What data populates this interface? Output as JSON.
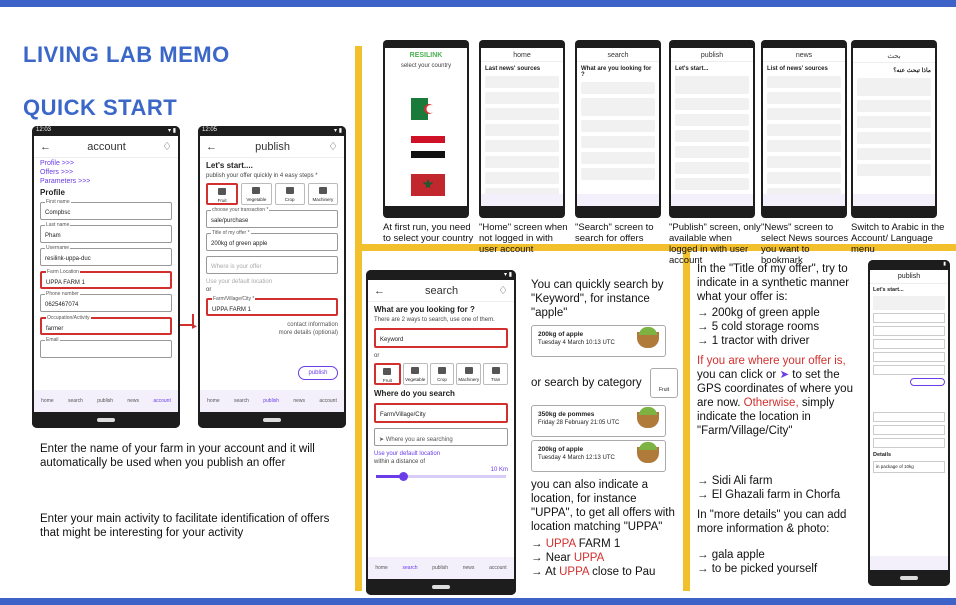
{
  "headings": {
    "memo": "LIVING LAB MEMO",
    "quick": "QUICK START"
  },
  "account_phone": {
    "time": "12:03",
    "title": "account",
    "links": [
      "Profile >>>",
      "Offers >>>",
      "Parameters >>>"
    ],
    "section": "Profile",
    "fields": [
      {
        "label": "First name",
        "value": "Compbsc"
      },
      {
        "label": "Last name",
        "value": "Pham"
      },
      {
        "label": "Username",
        "value": "resilink-uppa-duc"
      },
      {
        "label": "Farm Location",
        "value": "UPPA FARM 1"
      },
      {
        "label": "Phone number",
        "value": "0625467074"
      },
      {
        "label": "Occupation/Activity",
        "value": "farmer"
      },
      {
        "label": "Email",
        "value": ""
      }
    ],
    "nav": [
      "home",
      "search",
      "publish",
      "news",
      "account"
    ]
  },
  "publish_phone": {
    "time": "12:05",
    "title": "publish",
    "lets": "Let's start....",
    "sub": "publish your offer quickly in 4 easy steps *",
    "cats": [
      "Fruit",
      "Vegetable",
      "Crop",
      "Machinery",
      "T"
    ],
    "transaction_label": "choose your transaction *",
    "transaction": "sale/purchase",
    "title_label": "Title of my offer *",
    "title_value": "200kg of green apple",
    "where_placeholder": "Where is your offer",
    "use_default": "Use your default location",
    "or": "or",
    "farm_label": "Farm/Village/City *",
    "farm_value": "UPPA FARM 1",
    "contact": "contact information",
    "more": "more details (optional)",
    "publish_btn": "publish",
    "nav": [
      "home",
      "search",
      "publish",
      "news",
      "account"
    ]
  },
  "left_text": {
    "p1": "Enter the name of your farm in your account and it will automatically be used when you publish an offer",
    "p2": "Enter your main activity to facilitate identification of offers that might be interesting for your activity"
  },
  "thumbs": [
    {
      "title": "RESILINK",
      "caption": "At first run, you need to select your country",
      "extra": "select your country"
    },
    {
      "title": "home",
      "caption": "\"Home\" screen when not logged in with user account",
      "extra": "Last news' sources"
    },
    {
      "title": "search",
      "caption": "\"Search\" screen to search for offers",
      "extra": "What are you looking for ?"
    },
    {
      "title": "publish",
      "caption": "\"Publish\" screen, only available when logged in with user account",
      "extra": "Let's start..."
    },
    {
      "title": "news",
      "caption": "\"News\" screen to select News sources you want to bookmark",
      "extra": "List of news' sources"
    },
    {
      "title": "بحث",
      "caption": "Switch to Arabic in the Account/ Language menu",
      "extra": "ماذا تبحث عنه؟"
    }
  ],
  "search_phone": {
    "title": "search",
    "q": "What are you looking for ?",
    "hint": "There are 2 ways to search, use one of them.",
    "keyword": "Keyword",
    "or": "or",
    "cats": [
      "Fruit",
      "Vegetable",
      "Crop",
      "Machinery",
      "Tran"
    ],
    "where": "Where do you search",
    "farm": "Farm/Village/City",
    "where_searching": "Where you are searching",
    "use_default": "Use your default location",
    "within": "within a distance of",
    "km": "10 Km",
    "nav": [
      "home",
      "search",
      "publish",
      "news",
      "account"
    ]
  },
  "middle_text": {
    "t1": "You can quickly search by \"Keyword\", for instance \"apple\"",
    "t2": "or search by category",
    "fruit": "Fruit",
    "t3": "you can also indicate a location, for instance \"UPPA\", to get all offers with location matching \"UPPA\"",
    "b1_red": "UPPA",
    "b1": " FARM 1",
    "b2": "Near ",
    "b2_red": "UPPA",
    "b3": "At ",
    "b3_red": "UPPA",
    "b3_end": " close to Pau",
    "arrow": "→"
  },
  "offer_cards": [
    {
      "title": "200kg of apple",
      "date": "Tuesday 4 March 10:13 UTC"
    },
    {
      "title": "350kg de pommes",
      "date": "Friday 28 February 21:05 UTC"
    },
    {
      "title": "200kg of apple",
      "date": "Tuesday 4 March 12:13 UTC"
    }
  ],
  "right_text": {
    "intro": "In the \"Title of my offer\", try to indicate in a synthetic manner what your offer is:",
    "ex": [
      "200kg of green apple",
      "5 cold storage rooms",
      "1 tractor with driver"
    ],
    "gps_red": "If you are where your offer is,",
    "gps_1": " you can click or ",
    "gps_2": " to set the GPS coordinates of where you are now. ",
    "otherwise": "Otherwise,",
    "gps_3": " simply indicate the location in \"Farm/Village/City\"",
    "farms": [
      "Sidi Ali farm",
      "El Ghazali farm in Chorfa"
    ],
    "more": "In \"more details\" you can add more information & photo:",
    "details": [
      "gala apple",
      "to be picked yourself"
    ],
    "arrow": "→"
  },
  "right_phone": {
    "title": "publish",
    "lets": "Let's start...",
    "details": "Details",
    "pkg": "in package of 10kg"
  }
}
